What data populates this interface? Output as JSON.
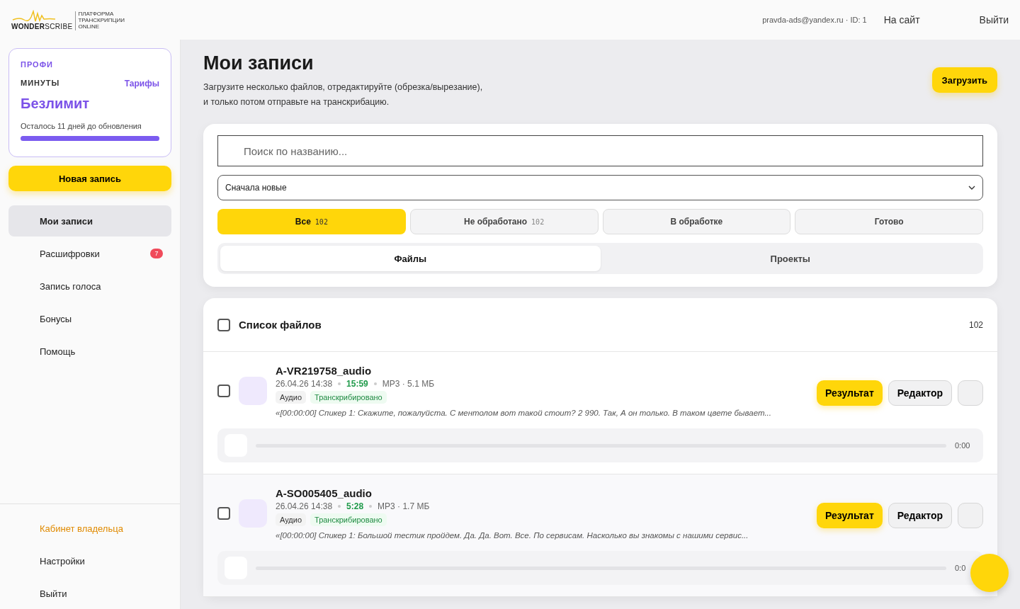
{
  "header": {
    "logo": "**WONDER**SCRIBE",
    "logo_tagline": "ПЛАТФОРМА ТРАНСКРИПЦИИ ONLINE",
    "account": "pravda-ads@yandex.ru · ID: 1",
    "links": [
      "На сайт",
      "Выйти"
    ]
  },
  "plan": {
    "name": "ПРОФИ",
    "minutes_label": "МИНУТЫ",
    "tariffs_link": "Тарифы",
    "minutes_value": "Безлимит",
    "note": "Осталось 11 дней до обновления",
    "level": 1
  },
  "new_button": "Новая запись",
  "nav": [
    {
      "label": "Мои записи",
      "selected": true
    },
    {
      "label": "Расшифровки",
      "selected": false,
      "badge": "7"
    },
    {
      "label": "Запись голоса",
      "selected": false
    },
    {
      "label": "Бонусы",
      "selected": false
    },
    {
      "label": "Помощь",
      "selected": false
    }
  ],
  "nav_bottom": [
    {
      "label": "Кабинет владельца",
      "kind": "accent"
    },
    {
      "label": "Настройки",
      "kind": "plain"
    },
    {
      "label": "Выйти",
      "kind": "plain"
    }
  ],
  "page": {
    "title": "Мои записи",
    "subtitle_lines": [
      "Загрузите несколько файлов, отредактируйте (обрезка/вырезание),",
      "и только потом отправьте на транскрибацию."
    ],
    "upload_button": "Загрузить"
  },
  "filters": {
    "search_placeholder": "Поиск по названию...",
    "sort": "Сначала новые",
    "statuses": [
      {
        "label": "Все",
        "count": "102",
        "selected": true
      },
      {
        "label": "Не обработано",
        "count": "102",
        "selected": false
      },
      {
        "label": "В обработке",
        "selected": false
      },
      {
        "label": "Готово",
        "selected": false
      }
    ],
    "tabs": [
      {
        "label": "Файлы",
        "selected": true
      },
      {
        "label": "Проекты",
        "selected": false
      }
    ]
  },
  "list": {
    "title": "Список файлов",
    "count": "102",
    "checked": false,
    "files": [
      {
        "name": "A-VR219758_audio",
        "date": "26.04.26 14:38",
        "duration": "15:59",
        "meta": "MP3 · 5.1 МБ",
        "tags": [
          "Аудио",
          "Транскрибировано"
        ],
        "excerpt": "«[00:00:00] Спикер 1: Скажите, пожалуйста. С ментолом вот такой стоит? 2 990. Так, А он только. В таком цвете бывает...",
        "checked": false,
        "buttons": [
          "Результат",
          "Редактор"
        ],
        "time": "0:00"
      },
      {
        "name": "A-SO005405_audio",
        "date": "26.04.26 14:38",
        "duration": "5:28",
        "meta": "MP3 · 1.7 МБ",
        "tags": [
          "Аудио",
          "Транскрибировано"
        ],
        "excerpt": "«[00:00:00] Спикер 1: Большой тестик пройдем. Да. Да. Вот. Все. По сервисам. Насколько вы знакомы с нашими сервис...",
        "checked": false,
        "buttons": [
          "Результат",
          "Редактор"
        ],
        "time": "0:0"
      }
    ]
  }
}
